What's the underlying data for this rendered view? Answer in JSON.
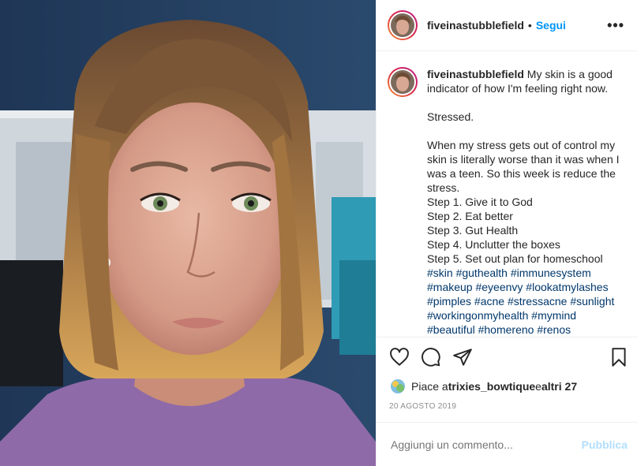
{
  "post": {
    "username": "fiveinastubblefield",
    "follow_label": "Segui",
    "dot": "•",
    "more_label": "•••"
  },
  "caption": {
    "username": "fiveinastubblefield",
    "text": " My skin is a good indicator of how I'm feeling right now.\n\nStressed.\n\nWhen my stress gets out of control my skin is literally worse than it was when I was a teen. So this week is reduce the stress.\nStep 1. Give it to God\nStep 2. Eat better\nStep 3. Gut Health\nStep 4. Unclutter the boxes\nStep 5. Set out plan for homeschool ",
    "hashtags": "#skin #guthealth #immunesystem #makeup #eyeenvy #lookatmylashes #pimples #acne #stressacne #sunlight #workingonmyhealth #mymind #beautiful #homereno #renos"
  },
  "actions": {
    "like_icon": "heart-icon",
    "comment_icon": "comment-icon",
    "share_icon": "paper-plane-icon",
    "save_icon": "bookmark-icon"
  },
  "likes": {
    "prefix": "Piace a ",
    "user": "trixies_bowtique",
    "middle": " e ",
    "others": "altri 27"
  },
  "date": "20 AGOSTO 2019",
  "comment": {
    "placeholder": "Aggiungi un commento...",
    "publish_label": "Pubblica"
  },
  "colors": {
    "accent": "#0095f6",
    "publish_disabled": "#b2dffc",
    "hashtag": "#00376b",
    "meta": "#8e8e8e"
  }
}
